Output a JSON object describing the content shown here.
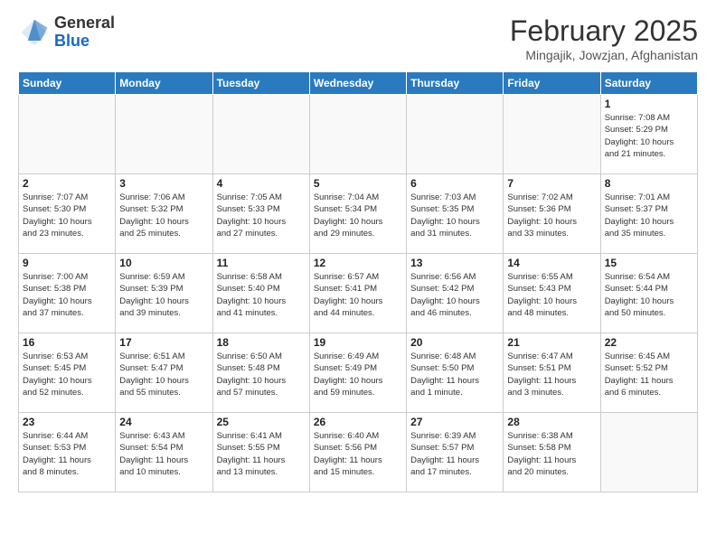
{
  "header": {
    "logo_general": "General",
    "logo_blue": "Blue",
    "month_year": "February 2025",
    "location": "Mingajik, Jowzjan, Afghanistan"
  },
  "weekdays": [
    "Sunday",
    "Monday",
    "Tuesday",
    "Wednesday",
    "Thursday",
    "Friday",
    "Saturday"
  ],
  "weeks": [
    [
      {
        "day": "",
        "info": ""
      },
      {
        "day": "",
        "info": ""
      },
      {
        "day": "",
        "info": ""
      },
      {
        "day": "",
        "info": ""
      },
      {
        "day": "",
        "info": ""
      },
      {
        "day": "",
        "info": ""
      },
      {
        "day": "1",
        "info": "Sunrise: 7:08 AM\nSunset: 5:29 PM\nDaylight: 10 hours\nand 21 minutes."
      }
    ],
    [
      {
        "day": "2",
        "info": "Sunrise: 7:07 AM\nSunset: 5:30 PM\nDaylight: 10 hours\nand 23 minutes."
      },
      {
        "day": "3",
        "info": "Sunrise: 7:06 AM\nSunset: 5:32 PM\nDaylight: 10 hours\nand 25 minutes."
      },
      {
        "day": "4",
        "info": "Sunrise: 7:05 AM\nSunset: 5:33 PM\nDaylight: 10 hours\nand 27 minutes."
      },
      {
        "day": "5",
        "info": "Sunrise: 7:04 AM\nSunset: 5:34 PM\nDaylight: 10 hours\nand 29 minutes."
      },
      {
        "day": "6",
        "info": "Sunrise: 7:03 AM\nSunset: 5:35 PM\nDaylight: 10 hours\nand 31 minutes."
      },
      {
        "day": "7",
        "info": "Sunrise: 7:02 AM\nSunset: 5:36 PM\nDaylight: 10 hours\nand 33 minutes."
      },
      {
        "day": "8",
        "info": "Sunrise: 7:01 AM\nSunset: 5:37 PM\nDaylight: 10 hours\nand 35 minutes."
      }
    ],
    [
      {
        "day": "9",
        "info": "Sunrise: 7:00 AM\nSunset: 5:38 PM\nDaylight: 10 hours\nand 37 minutes."
      },
      {
        "day": "10",
        "info": "Sunrise: 6:59 AM\nSunset: 5:39 PM\nDaylight: 10 hours\nand 39 minutes."
      },
      {
        "day": "11",
        "info": "Sunrise: 6:58 AM\nSunset: 5:40 PM\nDaylight: 10 hours\nand 41 minutes."
      },
      {
        "day": "12",
        "info": "Sunrise: 6:57 AM\nSunset: 5:41 PM\nDaylight: 10 hours\nand 44 minutes."
      },
      {
        "day": "13",
        "info": "Sunrise: 6:56 AM\nSunset: 5:42 PM\nDaylight: 10 hours\nand 46 minutes."
      },
      {
        "day": "14",
        "info": "Sunrise: 6:55 AM\nSunset: 5:43 PM\nDaylight: 10 hours\nand 48 minutes."
      },
      {
        "day": "15",
        "info": "Sunrise: 6:54 AM\nSunset: 5:44 PM\nDaylight: 10 hours\nand 50 minutes."
      }
    ],
    [
      {
        "day": "16",
        "info": "Sunrise: 6:53 AM\nSunset: 5:45 PM\nDaylight: 10 hours\nand 52 minutes."
      },
      {
        "day": "17",
        "info": "Sunrise: 6:51 AM\nSunset: 5:47 PM\nDaylight: 10 hours\nand 55 minutes."
      },
      {
        "day": "18",
        "info": "Sunrise: 6:50 AM\nSunset: 5:48 PM\nDaylight: 10 hours\nand 57 minutes."
      },
      {
        "day": "19",
        "info": "Sunrise: 6:49 AM\nSunset: 5:49 PM\nDaylight: 10 hours\nand 59 minutes."
      },
      {
        "day": "20",
        "info": "Sunrise: 6:48 AM\nSunset: 5:50 PM\nDaylight: 11 hours\nand 1 minute."
      },
      {
        "day": "21",
        "info": "Sunrise: 6:47 AM\nSunset: 5:51 PM\nDaylight: 11 hours\nand 3 minutes."
      },
      {
        "day": "22",
        "info": "Sunrise: 6:45 AM\nSunset: 5:52 PM\nDaylight: 11 hours\nand 6 minutes."
      }
    ],
    [
      {
        "day": "23",
        "info": "Sunrise: 6:44 AM\nSunset: 5:53 PM\nDaylight: 11 hours\nand 8 minutes."
      },
      {
        "day": "24",
        "info": "Sunrise: 6:43 AM\nSunset: 5:54 PM\nDaylight: 11 hours\nand 10 minutes."
      },
      {
        "day": "25",
        "info": "Sunrise: 6:41 AM\nSunset: 5:55 PM\nDaylight: 11 hours\nand 13 minutes."
      },
      {
        "day": "26",
        "info": "Sunrise: 6:40 AM\nSunset: 5:56 PM\nDaylight: 11 hours\nand 15 minutes."
      },
      {
        "day": "27",
        "info": "Sunrise: 6:39 AM\nSunset: 5:57 PM\nDaylight: 11 hours\nand 17 minutes."
      },
      {
        "day": "28",
        "info": "Sunrise: 6:38 AM\nSunset: 5:58 PM\nDaylight: 11 hours\nand 20 minutes."
      },
      {
        "day": "",
        "info": ""
      }
    ]
  ]
}
